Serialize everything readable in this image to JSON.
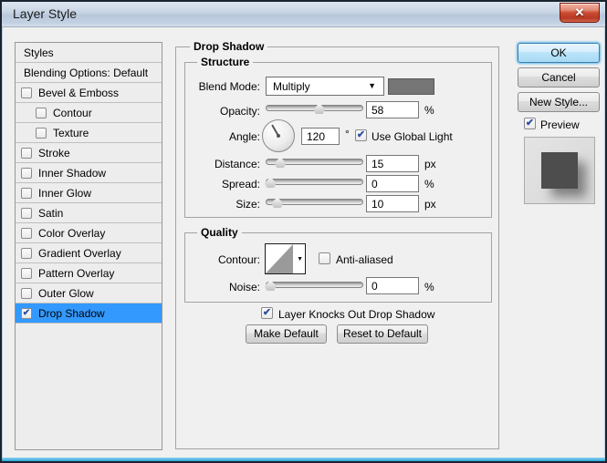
{
  "window": {
    "title": "Layer Style"
  },
  "icons": {
    "close": "✕",
    "dropdown": "▼",
    "check": "✔"
  },
  "colors": {
    "selection": "#3399ff",
    "shadow_swatch": "#757575",
    "dialog_bg": "#f0f0f0"
  },
  "sidebar": {
    "items": [
      {
        "label": "Styles"
      },
      {
        "label": "Blending Options: Default"
      },
      {
        "label": "Bevel & Emboss",
        "check": ""
      },
      {
        "label": "Contour",
        "check": ""
      },
      {
        "label": "Texture",
        "check": ""
      },
      {
        "label": "Stroke",
        "check": ""
      },
      {
        "label": "Inner Shadow",
        "check": ""
      },
      {
        "label": "Inner Glow",
        "check": ""
      },
      {
        "label": "Satin",
        "check": ""
      },
      {
        "label": "Color Overlay",
        "check": ""
      },
      {
        "label": "Gradient Overlay",
        "check": ""
      },
      {
        "label": "Pattern Overlay",
        "check": ""
      },
      {
        "label": "Outer Glow",
        "check": ""
      },
      {
        "label": "Drop Shadow",
        "check": "✔",
        "selected": true
      }
    ]
  },
  "panel": {
    "title": "Drop Shadow",
    "structure": {
      "title": "Structure",
      "blend_mode": {
        "label": "Blend Mode:",
        "value": "Multiply"
      },
      "opacity": {
        "label": "Opacity:",
        "value": "58",
        "unit": "%",
        "pos": 55
      },
      "angle": {
        "label": "Angle:",
        "value": "120",
        "unit": "°",
        "gl_check": "✔",
        "gl_label": "Use Global Light"
      },
      "distance": {
        "label": "Distance:",
        "value": "15",
        "unit": "px",
        "pos": 15
      },
      "spread": {
        "label": "Spread:",
        "value": "0",
        "unit": "%",
        "pos": 5
      },
      "size": {
        "label": "Size:",
        "value": "10",
        "unit": "px",
        "pos": 12
      }
    },
    "quality": {
      "title": "Quality",
      "contour_label": "Contour:",
      "anti_aliased": {
        "label": "Anti-aliased",
        "check": ""
      },
      "noise": {
        "label": "Noise:",
        "value": "0",
        "unit": "%",
        "pos": 5
      }
    },
    "knockout": {
      "label": "Layer Knocks Out Drop Shadow",
      "check": "✔"
    },
    "buttons": {
      "make_default": "Make Default",
      "reset_default": "Reset to Default"
    }
  },
  "actions": {
    "ok": "OK",
    "cancel": "Cancel",
    "new_style": "New Style...",
    "preview": {
      "label": "Preview",
      "check": "✔"
    }
  }
}
